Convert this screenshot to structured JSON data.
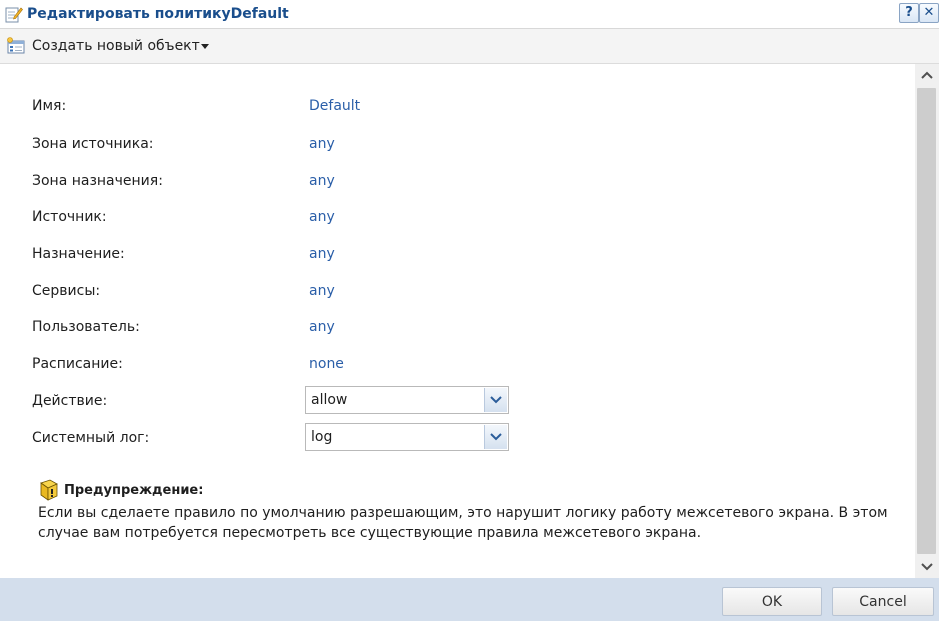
{
  "window": {
    "title": "Редактировать политикуDefault",
    "help_label": "?",
    "close_label": "✕"
  },
  "toolbar": {
    "create_label": "Создать новый объект"
  },
  "form": {
    "fields": [
      {
        "label": "Имя:",
        "value": "Default"
      },
      {
        "label": "Зона источника:",
        "value": "any"
      },
      {
        "label": "Зона назначения:",
        "value": "any"
      },
      {
        "label": "Источник:",
        "value": "any"
      },
      {
        "label": "Назначение:",
        "value": "any"
      },
      {
        "label": "Сервисы:",
        "value": "any"
      },
      {
        "label": "Пользователь:",
        "value": "any"
      },
      {
        "label": "Расписание:",
        "value": "none"
      }
    ],
    "action": {
      "label": "Действие:",
      "selected": "allow"
    },
    "syslog": {
      "label": "Системный лог:",
      "selected": "log"
    }
  },
  "warning": {
    "title": "Предупреждение:",
    "text": "Если вы сделаете правило по умолчанию разрешающим, это нарушит логику работу межсетевого экрана. В этом случае вам потребуется пересмотреть все существующие правила межсетевого экрана."
  },
  "footer": {
    "ok_label": "OK",
    "cancel_label": "Cancel"
  },
  "colors": {
    "title": "#1a4e8c",
    "value": "#2a5ea8",
    "footer_bg": "#d3deec"
  }
}
